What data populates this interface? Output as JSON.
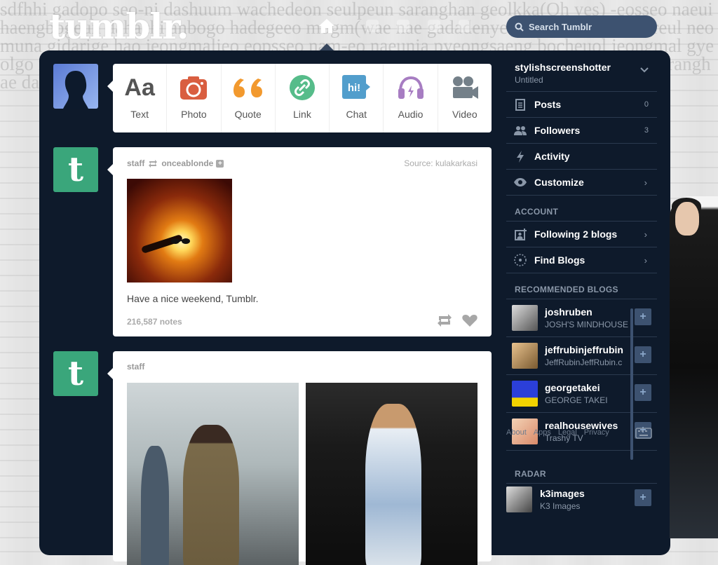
{
  "header": {
    "logo": "tumblr.",
    "search_placeholder": "Search Tumblr"
  },
  "composer": {
    "types": [
      {
        "label": "Text",
        "icon": "text-icon",
        "color": "#555555"
      },
      {
        "label": "Photo",
        "icon": "camera-icon",
        "color": "#d95e40"
      },
      {
        "label": "Quote",
        "icon": "quote-icon",
        "color": "#f2992e"
      },
      {
        "label": "Link",
        "icon": "link-icon",
        "color": "#56bc8a"
      },
      {
        "label": "Chat",
        "icon": "chat-icon",
        "color": "#529ecc"
      },
      {
        "label": "Audio",
        "icon": "headphones-icon",
        "color": "#a77dc2"
      },
      {
        "label": "Video",
        "icon": "video-camera-icon",
        "color": "#748089"
      }
    ]
  },
  "posts": [
    {
      "author": "staff",
      "reblogged_from": "onceablonde",
      "source_label": "Source:",
      "source": "kulakarkasi",
      "caption": "Have a nice weekend, Tumblr.",
      "notes": "216,587 notes"
    },
    {
      "author": "staff"
    }
  ],
  "sidebar": {
    "blog_name": "stylishscreenshotter",
    "blog_subtitle": "Untitled",
    "menu": [
      {
        "label": "Posts",
        "count": "0",
        "icon": "document-icon"
      },
      {
        "label": "Followers",
        "count": "3",
        "icon": "people-icon"
      },
      {
        "label": "Activity",
        "count": "",
        "icon": "lightning-icon"
      },
      {
        "label": "Customize",
        "count": "",
        "icon": "eye-icon"
      }
    ],
    "account_heading": "ACCOUNT",
    "account": [
      {
        "label": "Following 2 blogs",
        "icon": "add-person-icon"
      },
      {
        "label": "Find Blogs",
        "icon": "compass-icon"
      }
    ],
    "recommended_heading": "RECOMMENDED BLOGS",
    "recommended": [
      {
        "name": "joshruben",
        "title": "JOSH'S MINDHOUSE"
      },
      {
        "name": "jeffrubinjeffrubin",
        "title": "JeffRubinJeffRubin.c"
      },
      {
        "name": "georgetakei",
        "title": "GEORGE TAKEI"
      },
      {
        "name": "realhousewives",
        "title": "Trashy TV"
      }
    ],
    "footer_links": [
      "About",
      "Apps",
      "Legal",
      "Privacy"
    ],
    "radar_heading": "RADAR",
    "radar": [
      {
        "name": "k3images",
        "title": "K3 Images"
      }
    ]
  },
  "background_text": "sdfhhi gadopo seo-ni dashuum wachedeon seulpeun saranghan geolkka(Oh yes) -eosseo naeui haengbogeun dahachi anbogo hadegeeo mogm(wae nae gadadenyeo beolo nadeun na-reul neomuna gidarige hao jeongmaljeo eopsseo nam-eo naeunia pyeongsaeng bocheuol jeongmal gyeolgo neomanhae wae(wae! wae!) bolaenieonie -gyeo chuhwae bisik nadeun neomuna saranghae daeeorodo eoptgo geulleun bam taeyang"
}
